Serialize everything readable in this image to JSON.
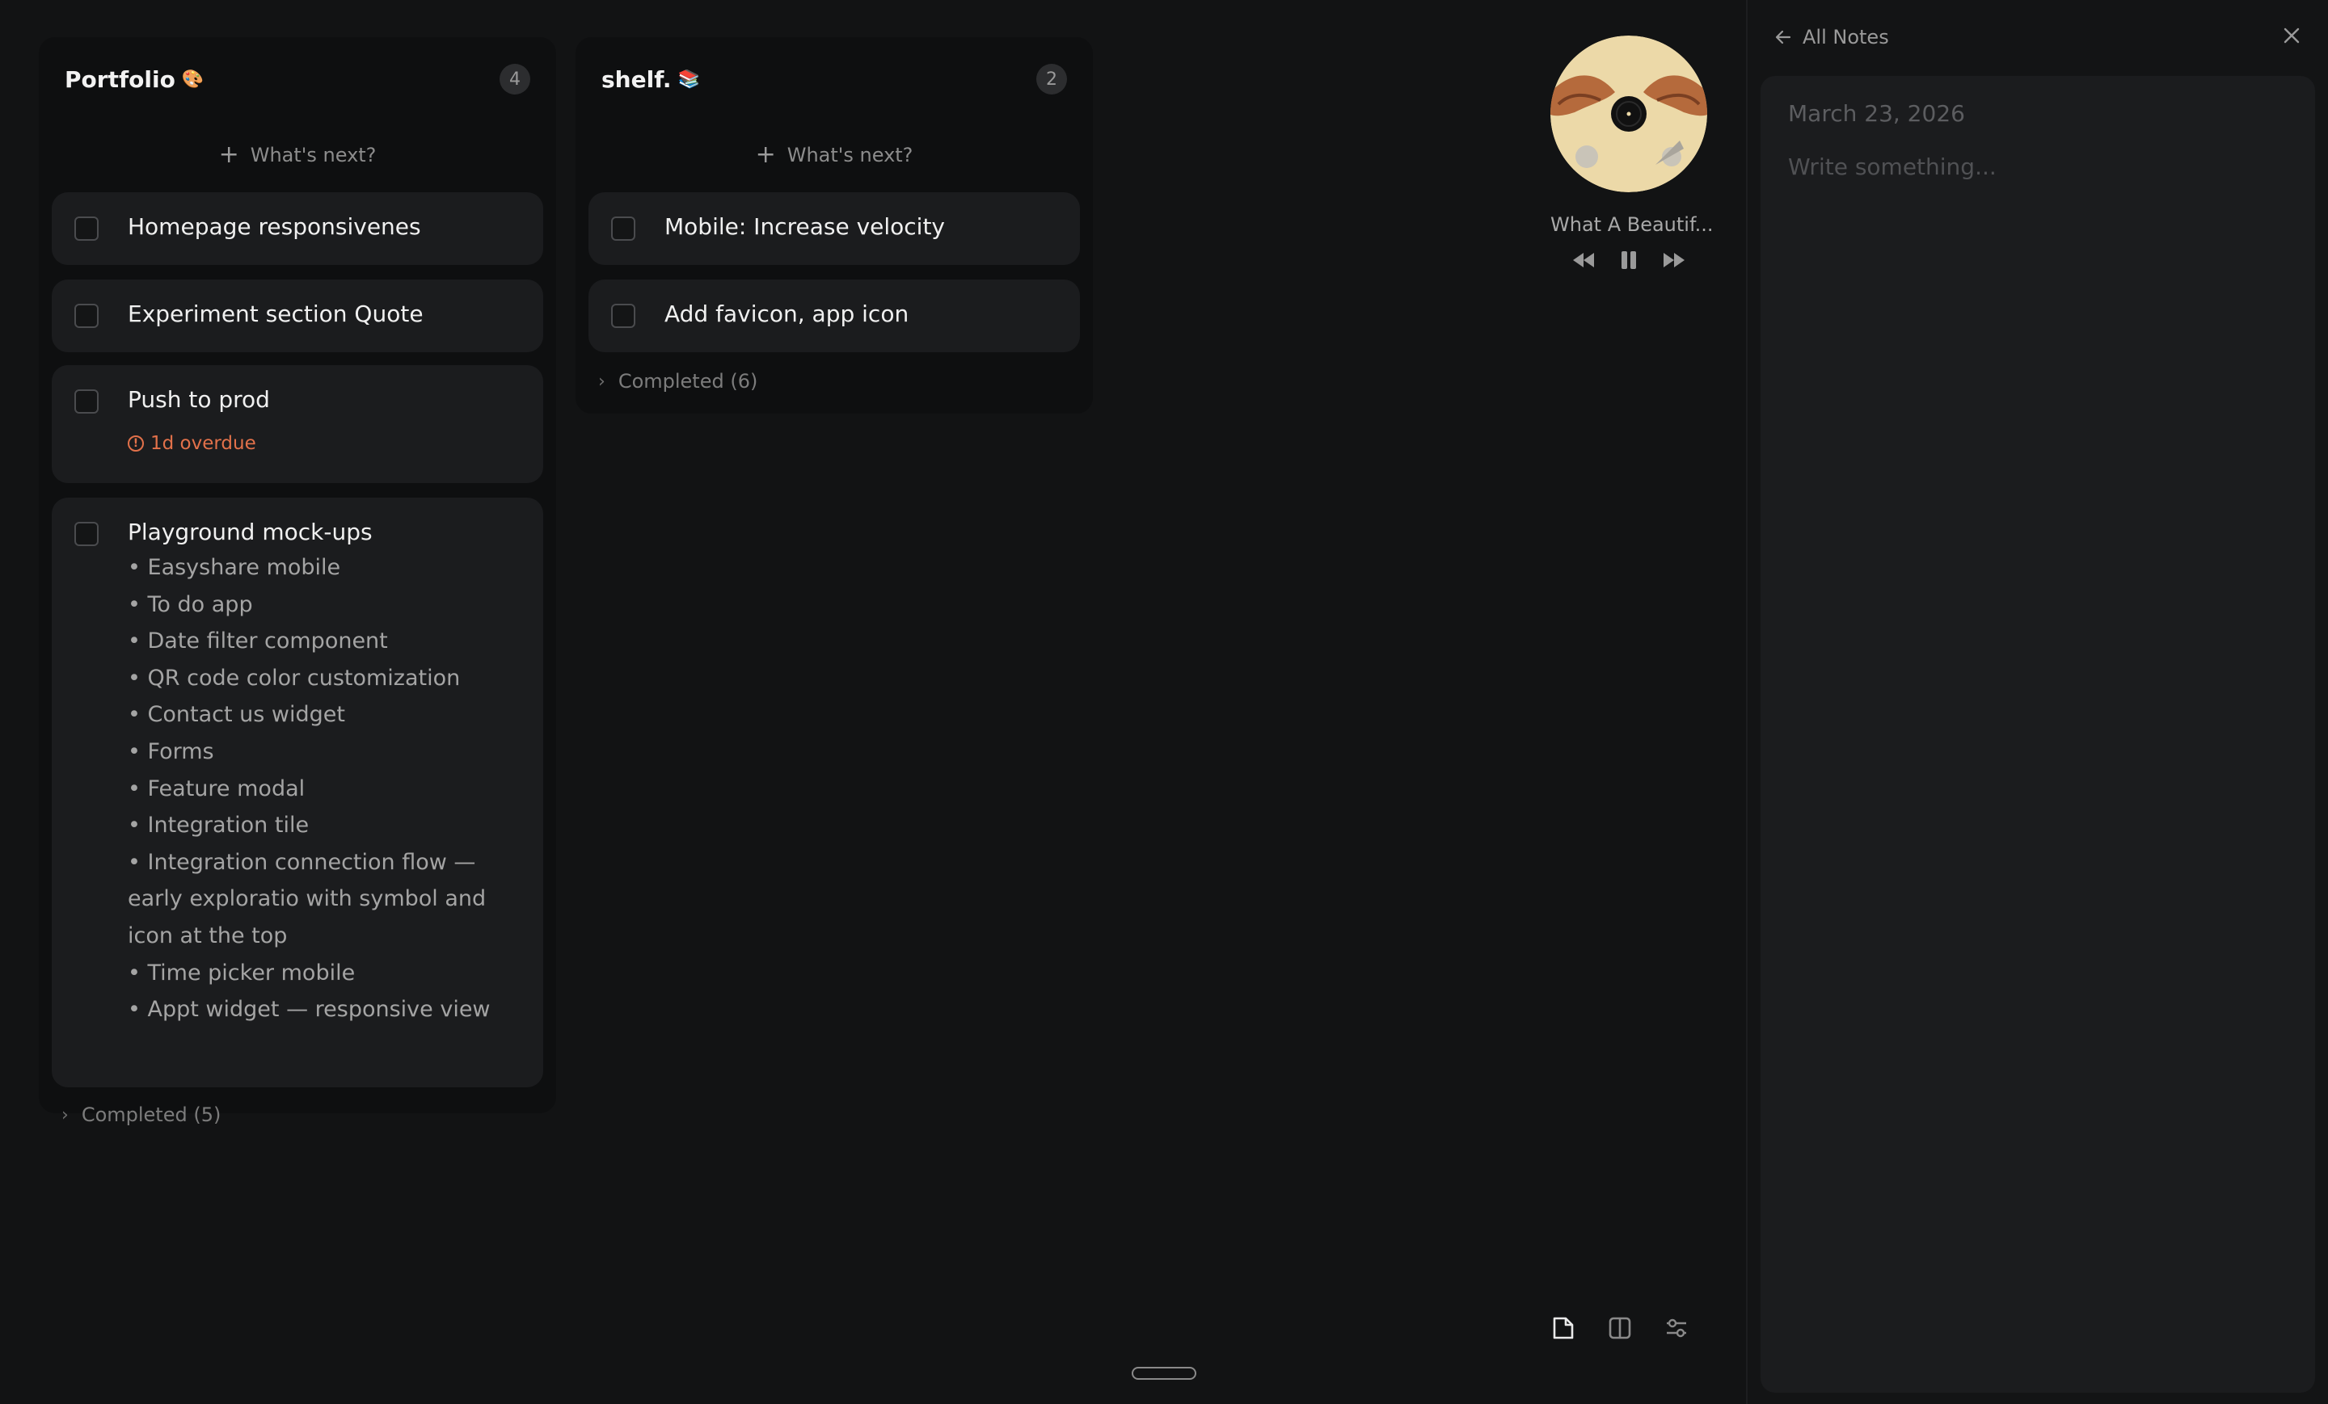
{
  "columns": [
    {
      "title": "Portfolio",
      "emoji": "🎨",
      "count": "4",
      "add_placeholder": "What's next?",
      "tasks": [
        {
          "title": "Homepage responsivenes"
        },
        {
          "title": "Experiment section Quote"
        },
        {
          "title": "Push to prod",
          "overdue": "1d overdue"
        },
        {
          "title": "Playground mock-ups",
          "subitems": [
            "• Easyshare mobile",
            "• To do app",
            "• Date filter component",
            "• QR code color customization",
            "• Contact us widget",
            "• Forms",
            "• Feature modal",
            "• Integration tile",
            "• Integration connection flow — early exploratio with symbol and icon at the top",
            "• Time picker mobile",
            "• Appt widget — responsive view"
          ]
        }
      ],
      "completed": "Completed (5)"
    },
    {
      "title": "shelf.",
      "emoji": "📚",
      "count": "2",
      "add_placeholder": "What's next?",
      "tasks": [
        {
          "title": "Mobile: Increase velocity"
        },
        {
          "title": "Add favicon, app icon"
        }
      ],
      "completed": "Completed (6)"
    }
  ],
  "player": {
    "track": "What A Beautif...",
    "icons": {
      "prev": "rewind-icon",
      "pause": "pause-icon",
      "next": "fast-forward-icon"
    }
  },
  "toolbar": {
    "icons": [
      "note-icon",
      "split-view-icon",
      "sliders-icon"
    ]
  },
  "notes": {
    "back_label": "All Notes",
    "date": "March 23, 2026",
    "placeholder": "Write something..."
  },
  "colors": {
    "background": "#121314",
    "column": "#0e0f10",
    "card": "#1b1c1e",
    "overdue": "#e2714a"
  }
}
